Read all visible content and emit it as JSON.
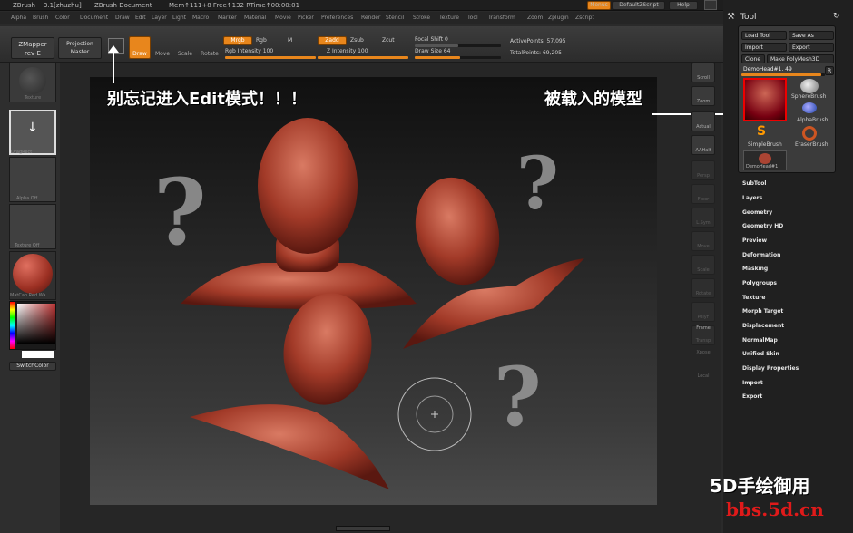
{
  "titlebar": {
    "app": "ZBrush",
    "version": "3.1[zhuzhu]",
    "doc": "ZBrush Document",
    "mem": "Mem↑111+8 Free↑132 RTime↑00:00:01",
    "menus_btn": "Menus",
    "script_btn": "DefaultZScript",
    "help_btn": "Help"
  },
  "menu": [
    "Alpha",
    "Brush",
    "Color",
    "Document",
    "Draw",
    "Edit",
    "Layer",
    "Light",
    "Macro",
    "Marker",
    "Material",
    "Movie",
    "Picker",
    "Preferences",
    "Render",
    "Stencil",
    "Stroke",
    "Texture",
    "Tool",
    "Transform",
    "Zoom",
    "Zplugin",
    "Zscript"
  ],
  "shelf": {
    "zmapper": "ZMapper",
    "zmapper_sub": "rev-E",
    "projection": "Projection",
    "master": "Master",
    "draw": "Draw",
    "move": "Move",
    "scale": "Scale",
    "rotate": "Rotate",
    "mrgb": "Mrgb",
    "rgb": "Rgb",
    "m": "M",
    "rgb_intensity_label": "Rgb Intensity",
    "rgb_intensity": "100",
    "zadd": "Zadd",
    "zsub": "Zsub",
    "zcut": "Zcut",
    "z_intensity_label": "Z Intensity",
    "z_intensity": "100",
    "focal_label": "Focal Shift",
    "focal": "0",
    "drawsize_label": "Draw Size",
    "drawsize": "64",
    "active_label": "ActivePoints:",
    "active": "57,095",
    "total_label": "TotalPoints:",
    "total": "69,205"
  },
  "left": {
    "texture": "Texture",
    "dragrect": "DragRect",
    "alpha": "Alpha  Off",
    "texture_off": "Texture  Off",
    "matcap": "MatCap  Red  Wa",
    "switch": "SwitchColor"
  },
  "righttools": [
    "Scroll",
    "Zoom",
    "Actual",
    "AAHalf",
    "Persp",
    "Floor",
    "L.Sym",
    "Move",
    "Scale",
    "Rotate",
    "PolyF",
    "Transp",
    "Frame",
    "Xpose",
    "Local"
  ],
  "toolpanel": {
    "title": "Tool",
    "load": "Load Tool",
    "save": "Save As",
    "import": "Import",
    "export": "Export",
    "clone": "Clone",
    "make": "Make PolyMesh3D",
    "current": "DemoHead#1. 49",
    "r": "R",
    "thumbs": [
      "DemoHead#1",
      "SphereBrush",
      "AlphaBrush",
      "SimpleBrush",
      "EraserBrush",
      "DemoHead#1"
    ]
  },
  "subpalettes": [
    "SubTool",
    "Layers",
    "Geometry",
    "Geometry HD",
    "Preview",
    "Deformation",
    "Masking",
    "Polygroups",
    "Texture",
    "Morph Target",
    "Displacement",
    "NormalMap",
    "Unified Skin",
    "Display Properties",
    "Import",
    "Export"
  ],
  "annotations": {
    "left_note": "别忘记进入Edit模式！！！",
    "right_note": "被载入的模型",
    "q": "?"
  },
  "watermark": {
    "line1": "5D手绘御用",
    "line2": "bbs.5d.cn"
  }
}
